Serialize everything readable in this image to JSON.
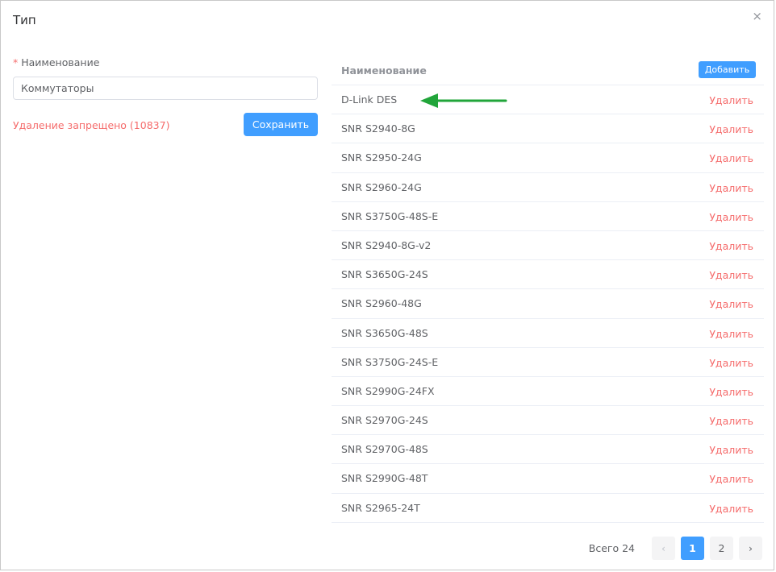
{
  "dialog": {
    "title": "Тип",
    "close_icon": "×"
  },
  "form": {
    "required_mark": "*",
    "name_label": "Наименование",
    "name_value": "Коммутаторы",
    "error_text": "Удаление запрещено (10837)",
    "save_label": "Сохранить"
  },
  "table": {
    "header_name": "Наименование",
    "add_label": "Добавить",
    "delete_label": "Удалить",
    "rows": [
      "D-Link DES",
      "SNR S2940-8G",
      "SNR S2950-24G",
      "SNR S2960-24G",
      "SNR S3750G-48S-E",
      "SNR S2940-8G-v2",
      "SNR S3650G-24S",
      "SNR S2960-48G",
      "SNR S3650G-48S",
      "SNR S3750G-24S-E",
      "SNR S2990G-24FX",
      "SNR S2970G-24S",
      "SNR S2970G-48S",
      "SNR S2990G-48T",
      "SNR S2965-24T"
    ]
  },
  "pagination": {
    "total_text": "Всего 24",
    "prev_icon": "‹",
    "next_icon": "›",
    "pages": [
      "1",
      "2"
    ],
    "current_page": "1"
  },
  "colors": {
    "accent": "#409eff",
    "danger": "#f56c6c",
    "arrow": "#21a53a"
  }
}
